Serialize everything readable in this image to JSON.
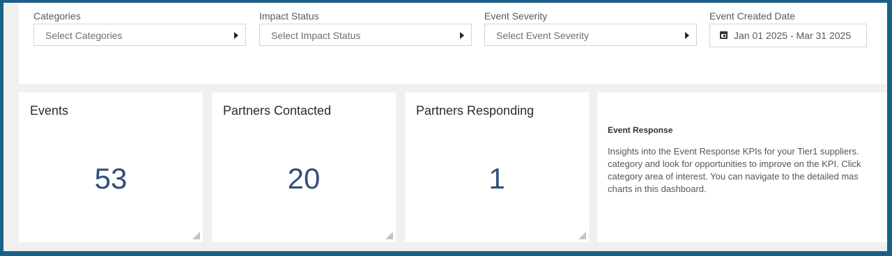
{
  "filters": {
    "categories": {
      "label": "Categories",
      "placeholder": "Select Categories"
    },
    "impact_status": {
      "label": "Impact Status",
      "placeholder": "Select Impact Status"
    },
    "event_severity": {
      "label": "Event Severity",
      "placeholder": "Select Event Severity"
    },
    "event_created_date": {
      "label": "Event Created Date",
      "value": "Jan 01 2025 - Mar 31 2025"
    }
  },
  "kpis": [
    {
      "title": "Events",
      "value": "53"
    },
    {
      "title": "Partners Contacted",
      "value": "20"
    },
    {
      "title": "Partners Responding",
      "value": "1"
    }
  ],
  "info": {
    "title": "Event Response",
    "lines": [
      "Insights into the Event Response KPIs for your Tier1 suppliers.",
      "category and look for opportunities to improve on the KPI. Click",
      "category area of interest. You can navigate to the detailed mas",
      "charts in this dashboard."
    ]
  },
  "colors": {
    "border": "#1b5f86",
    "kpi_value": "#2f4f7a",
    "background": "#f0f0f0"
  }
}
